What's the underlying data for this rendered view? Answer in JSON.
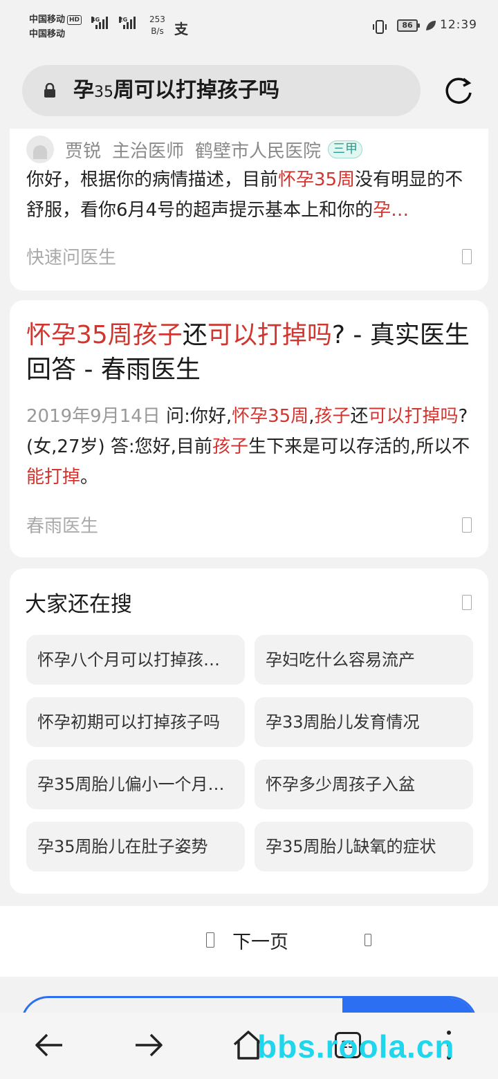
{
  "status_bar": {
    "carrier1": "中国移动",
    "carrier2": "中国移动",
    "hd": "HD",
    "net1": "4G",
    "net2": "2G",
    "speed_value": "253",
    "speed_unit": "B/s",
    "alipay_icon": "支",
    "battery": "86",
    "time": "12:39"
  },
  "address_bar": {
    "query_prefix": "孕",
    "query_num": "35",
    "query_rest": "周可以打掉孩子吗",
    "lock_icon": "lock-icon",
    "refresh_icon": "refresh-icon"
  },
  "result1": {
    "doctor_name": "贾锐",
    "doctor_title": "主治医师",
    "hospital": "鹤壁市人民医院",
    "badge": "三甲",
    "snippet": [
      {
        "t": "你好，根据你的病情描述，目前",
        "hl": false
      },
      {
        "t": "怀孕35周",
        "hl": true
      },
      {
        "t": "没有明显的不舒服，看你6月4号的超声提示基本上和你的",
        "hl": false
      },
      {
        "t": "孕…",
        "hl": true
      }
    ],
    "source": "快速问医生"
  },
  "result2": {
    "title": [
      {
        "t": "怀孕35周孩子",
        "hl": true
      },
      {
        "t": "还",
        "hl": false
      },
      {
        "t": "可以打掉吗",
        "hl": true
      },
      {
        "t": "? - 真实医生回答 - 春雨医生",
        "hl": false
      }
    ],
    "date": "2019年9月14日",
    "snippet": [
      {
        "t": "问:你好,",
        "hl": false
      },
      {
        "t": "怀孕35周",
        "hl": true
      },
      {
        "t": ",",
        "hl": false
      },
      {
        "t": "孩子",
        "hl": true
      },
      {
        "t": "还",
        "hl": false
      },
      {
        "t": "可以打掉吗",
        "hl": true
      },
      {
        "t": "?(女,27岁) 答:您好,目前",
        "hl": false
      },
      {
        "t": "孩子",
        "hl": true
      },
      {
        "t": "生下来是可以存活的,所以不",
        "hl": false
      },
      {
        "t": "能打掉",
        "hl": true
      },
      {
        "t": "。",
        "hl": false
      }
    ],
    "source": "春雨医生"
  },
  "related": {
    "title": "大家还在搜",
    "items": [
      "怀孕八个月可以打掉孩…",
      "孕妇吃什么容易流产",
      "怀孕初期可以打掉孩子吗",
      "孕33周胎儿发育情况",
      "孕35周胎儿偏小一个月…",
      "怀孕多少周孩子入盆",
      "孕35周胎儿在肚子姿势",
      "孕35周胎儿缺氧的症状"
    ]
  },
  "pagination": {
    "next_label": "下一页"
  },
  "toolbar": {
    "tab_count": "25",
    "watermark": "bbs.roola.cn"
  }
}
